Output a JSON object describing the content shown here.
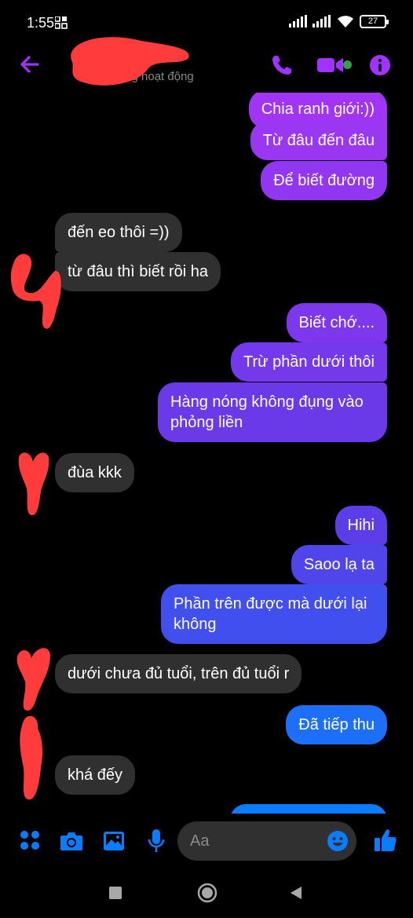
{
  "status_bar": {
    "time": "1:55",
    "battery": "27"
  },
  "header": {
    "contact_status": "Đang hoạt động"
  },
  "messages": [
    {
      "side": "sent",
      "text": "Chia ranh giới:))"
    },
    {
      "side": "sent",
      "text": "Từ đâu đến đâu"
    },
    {
      "side": "sent",
      "text": "Để biết đường"
    },
    {
      "side": "recv",
      "text": "đến eo thôi =))"
    },
    {
      "side": "recv",
      "text": "từ đâu thì biết rồi ha"
    },
    {
      "side": "sent",
      "text": "Biết chớ...."
    },
    {
      "side": "sent",
      "text": "Trừ phần dưới thôi"
    },
    {
      "side": "sent",
      "text": "Hàng nóng không đụng vào phỏng liền"
    },
    {
      "side": "recv",
      "text": "đùa kkk"
    },
    {
      "side": "sent",
      "text": "Hihi"
    },
    {
      "side": "sent",
      "text": "Saoo lạ ta"
    },
    {
      "side": "sent",
      "text": "Phần trên được mà dưới lại không"
    },
    {
      "side": "recv",
      "text": "dưới chưa đủ tuổi, trên đủ tuổi r"
    },
    {
      "side": "sent",
      "text": "Đã tiếp thu"
    },
    {
      "side": "recv",
      "text": "khá đếy"
    }
  ],
  "composer": {
    "placeholder": "Aa"
  },
  "colors": {
    "accent_purple": "#a033ff",
    "accent_blue": "#0a7cff",
    "received_bubble": "#303030",
    "redaction_red": "#ff3b3b"
  },
  "icons": {
    "header": [
      "back-arrow-icon",
      "phone-icon",
      "video-camera-icon",
      "info-icon"
    ],
    "composer": [
      "apps-icon",
      "camera-icon",
      "gallery-icon",
      "microphone-icon",
      "emoji-icon",
      "thumbs-up-icon"
    ],
    "navbar": [
      "recents-icon",
      "home-icon",
      "back-icon"
    ]
  }
}
